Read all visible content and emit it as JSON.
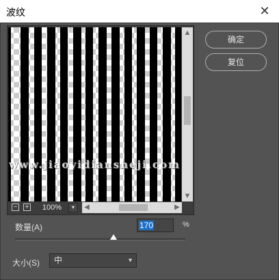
{
  "window": {
    "title": "波纹",
    "close_glyph": "✕"
  },
  "preview": {
    "watermark": "www.jiaoyidiansheji.com",
    "zoom_value": "100%",
    "zoom_minus": "−",
    "zoom_plus": "+"
  },
  "buttons": {
    "ok": "确定",
    "reset": "复位"
  },
  "amount": {
    "label": "数量(A)",
    "value": "170",
    "unit": "%",
    "slider_fraction": 0.58
  },
  "size": {
    "label": "大小(S)",
    "selected": "中"
  },
  "icons": {
    "scroll_up": "▲",
    "scroll_down": "▼",
    "scroll_left": "◀",
    "scroll_right": "▶",
    "dropdown": "▾"
  },
  "colors": {
    "panel": "#535353",
    "selection": "#1a6fc8"
  }
}
